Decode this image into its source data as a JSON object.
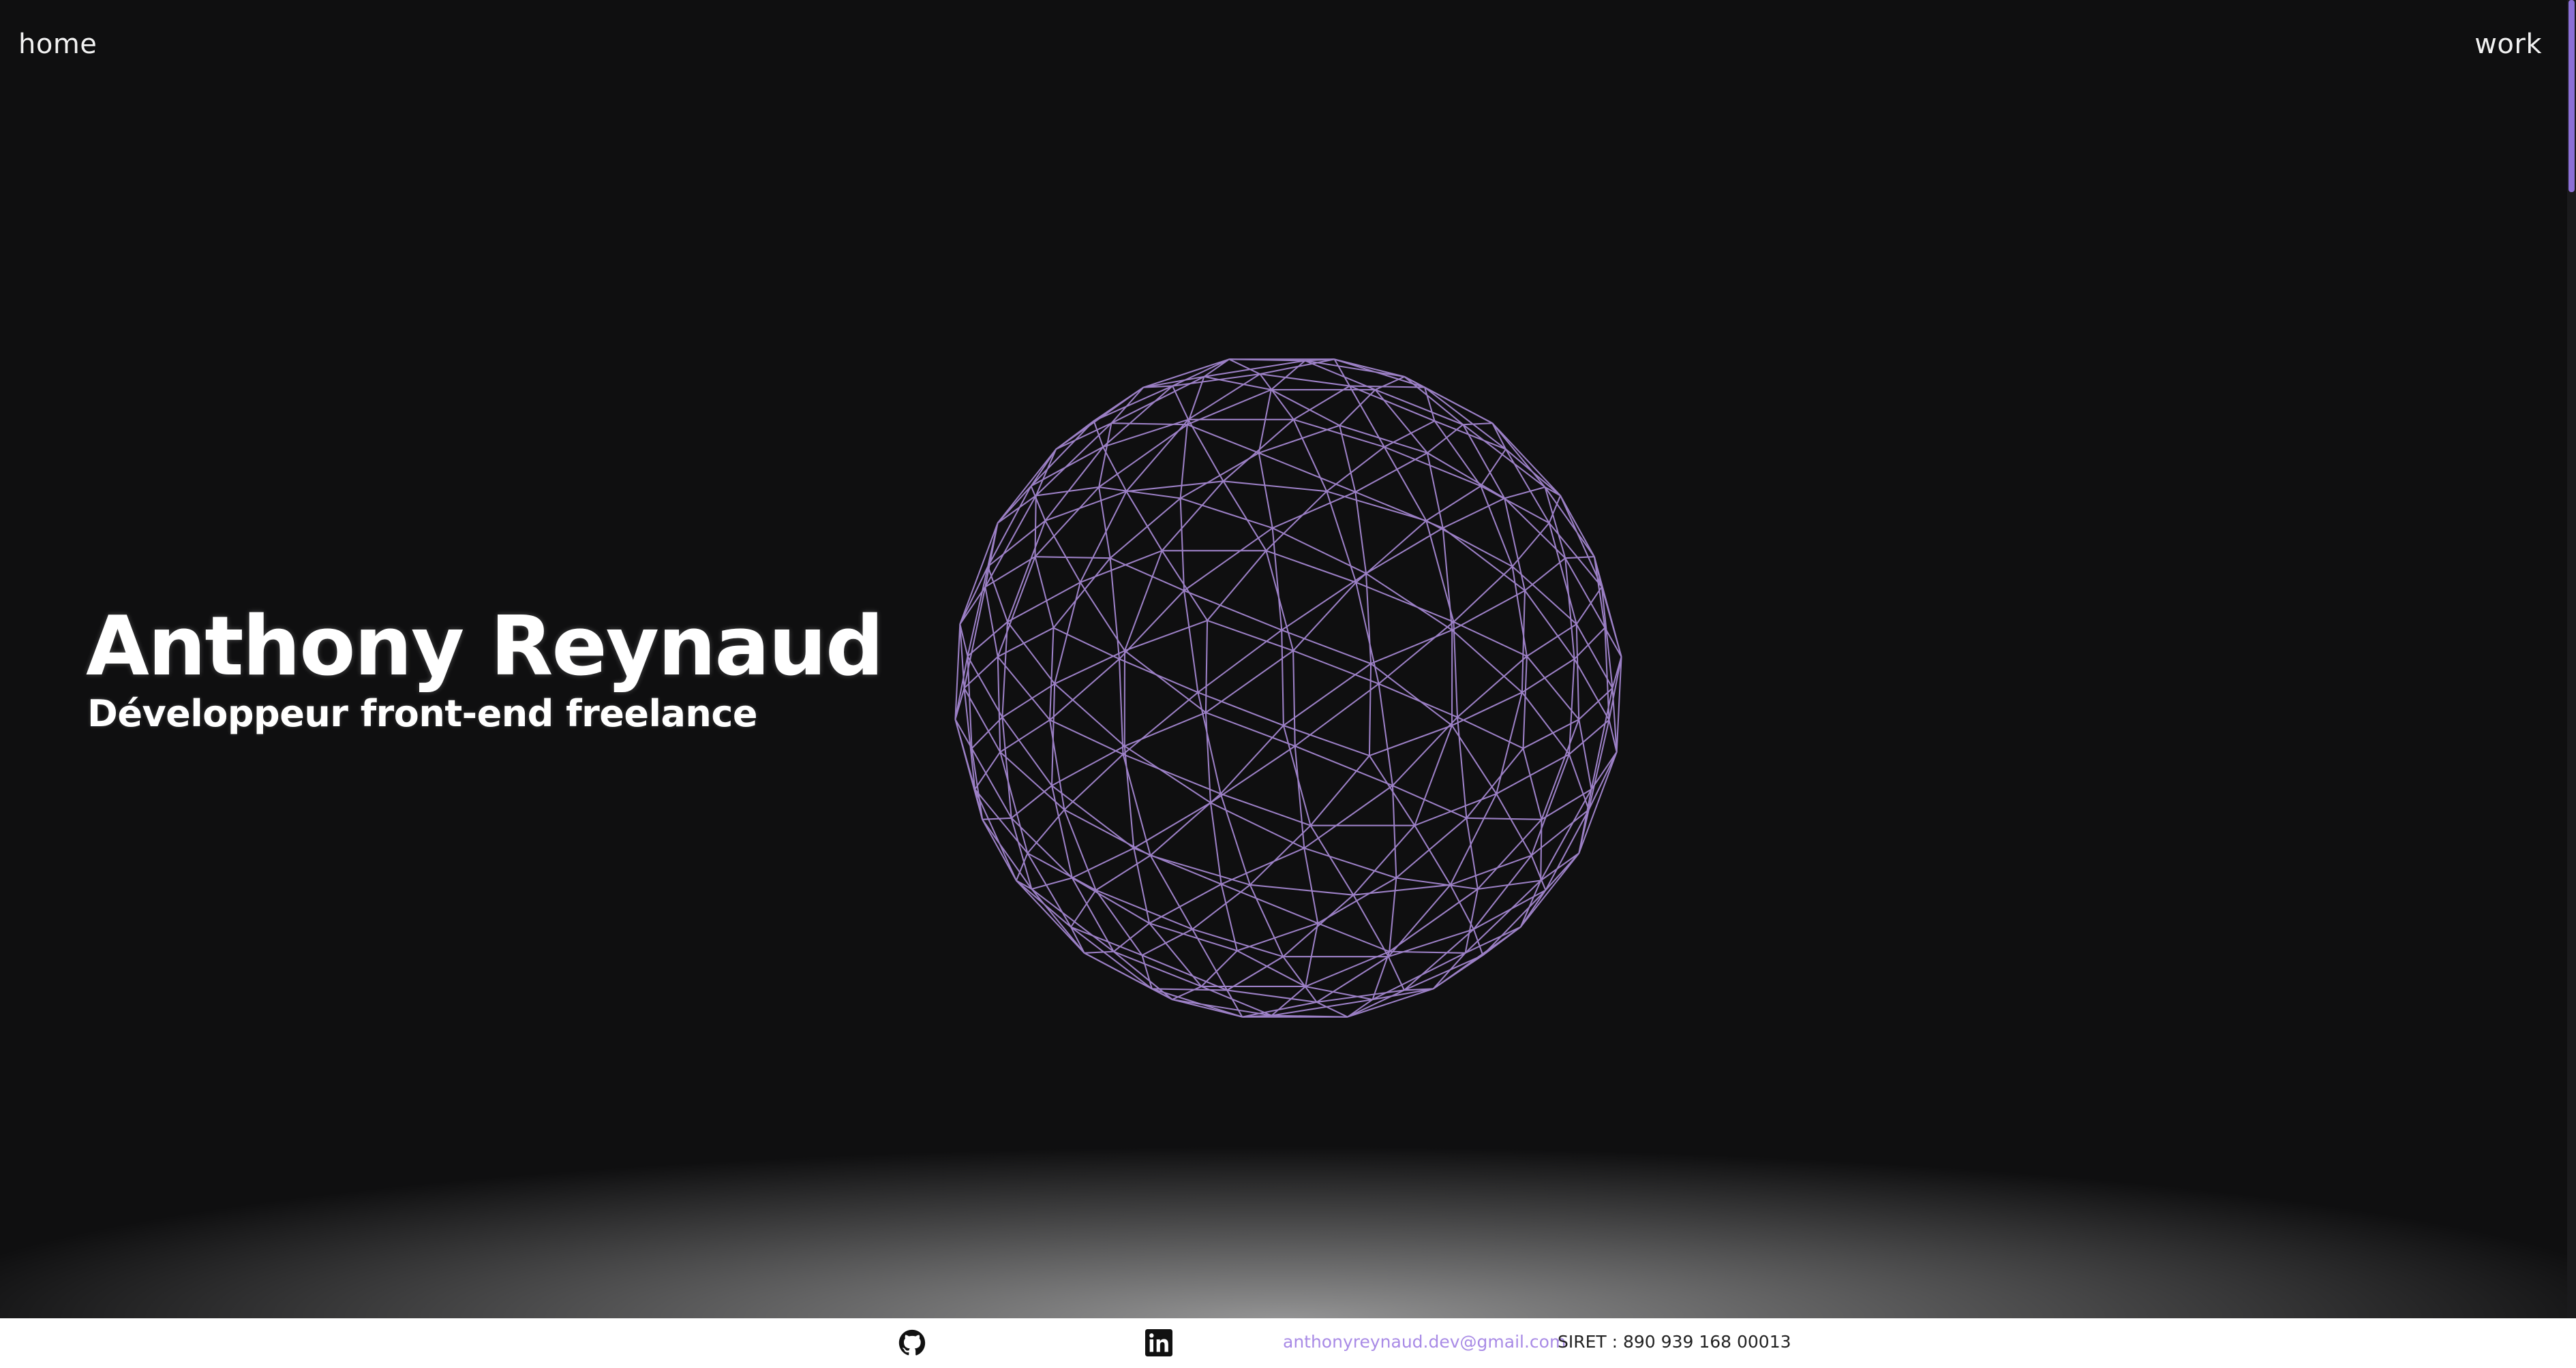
{
  "nav": {
    "home": "home",
    "work": "work"
  },
  "hero": {
    "title": "Anthony Reynaud",
    "subtitle": "Développeur front-end freelance"
  },
  "globe": {
    "icon": "wireframe-globe-icon",
    "stroke_color": "#9c80c6"
  },
  "footer": {
    "github_icon": "github-icon",
    "linkedin_icon": "linkedin-icon",
    "email": "anthonyreynaud.dev@gmail.com",
    "siret": "SIRET : 890 939 168 00013"
  },
  "colors": {
    "background": "#0f0f10",
    "accent": "#a98be6",
    "scroll_thumb": "#8b6fd6"
  }
}
